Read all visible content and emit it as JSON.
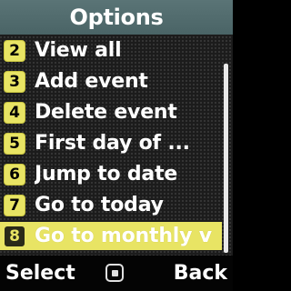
{
  "header": {
    "title": "Options"
  },
  "menu": {
    "items": [
      {
        "number": "2",
        "label": "View all"
      },
      {
        "number": "3",
        "label": "Add event"
      },
      {
        "number": "4",
        "label": "Delete event"
      },
      {
        "number": "5",
        "label": "First day of ..."
      },
      {
        "number": "6",
        "label": "Jump to date"
      },
      {
        "number": "7",
        "label": "Go to today"
      },
      {
        "number": "8",
        "label": "Go to monthly v"
      }
    ],
    "selected_index": 6
  },
  "softkeys": {
    "left": "Select",
    "center_icon": "select-square-icon",
    "right": "Back"
  },
  "colors": {
    "accent": "#e8e464",
    "header_bg": "#5a7476",
    "background": "#1c1c1c"
  }
}
